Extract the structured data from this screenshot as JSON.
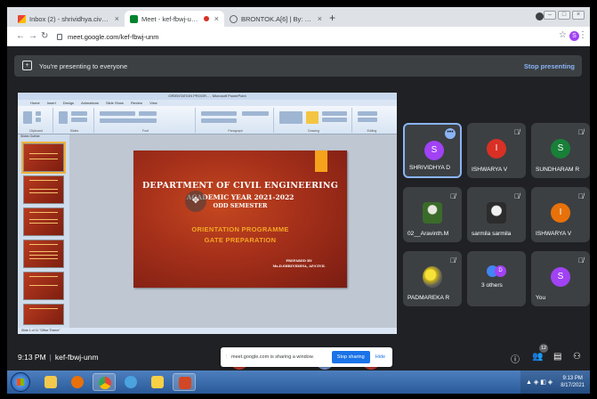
{
  "browser": {
    "tabs": [
      {
        "title": "Inbox (2) - shrividhya.civil@kingstonengg...",
        "favicon": "gmail-icon"
      },
      {
        "title": "Meet - kef-fbwj-unm",
        "favicon": "meet-icon",
        "recording": true
      },
      {
        "title": "BRONTOK.A[6] | By: HVM31 -- Ju...",
        "favicon": "globe-icon"
      }
    ],
    "close_glyph": "×",
    "new_tab_glyph": "+",
    "address": "meet.google.com/kef-fbwj-unm",
    "profile_initial": "S"
  },
  "banner": {
    "text": "You're presenting to everyone",
    "action": "Stop presenting"
  },
  "presentation": {
    "app_title": "ORIENTATION PROGR... - Microsoft PowerPoint",
    "menu": [
      "Home",
      "Insert",
      "Design",
      "Animations",
      "Slide Show",
      "Review",
      "View"
    ],
    "ribbon_groups": [
      "Clipboard",
      "Slides",
      "Font",
      "Paragraph",
      "Drawing",
      "Editing"
    ],
    "left_tabs": "Slides   Outline",
    "status": "Slide 1 of 11    \"Office Theme\"",
    "slide": {
      "heading": "DEPARTMENT OF CIVIL ENGINEERING",
      "year_line": "ACADEMIC YEAR 2021-2022",
      "semester": "ODD SEMESTER",
      "line1": "ORIENTATION PROGRAMME",
      "line2": "GATE PREPARATION",
      "prepared_by": "PREPARED BY",
      "author": "Ms.D.SHRIVIDHYA, AP/CIVIL"
    }
  },
  "participants": [
    {
      "name": "SHRIVIDHYA D",
      "initial": "S",
      "color": "#a142f4",
      "speaking": true
    },
    {
      "name": "ISHWARYA V",
      "initial": "I",
      "color": "#d93025"
    },
    {
      "name": "SUNDHARAM R",
      "initial": "S",
      "color": "#188038"
    },
    {
      "name": "02__Aravinth.M",
      "photo": true
    },
    {
      "name": "sarmila sarmila",
      "photo": true
    },
    {
      "name": "ISHWARYA V",
      "initial": "I",
      "color": "#e8710a"
    },
    {
      "name": "PADMAREKA R",
      "photo": true
    },
    {
      "name": "3 others",
      "group": [
        "#4285f4",
        "#a142f4"
      ],
      "group_initials": [
        "",
        "D"
      ]
    },
    {
      "name": "You",
      "initial": "S",
      "color": "#a142f4"
    }
  ],
  "bottom": {
    "time": "9:13 PM",
    "separator": "|",
    "meeting_code": "kef-fbwj-unm",
    "people_count": "12"
  },
  "share_bar": {
    "message": "meet.google.com is sharing a window.",
    "stop": "Stop sharing",
    "hide": "Hide"
  },
  "taskbar": {
    "clock_time": "9:13 PM",
    "clock_date": "8/17/2021"
  }
}
